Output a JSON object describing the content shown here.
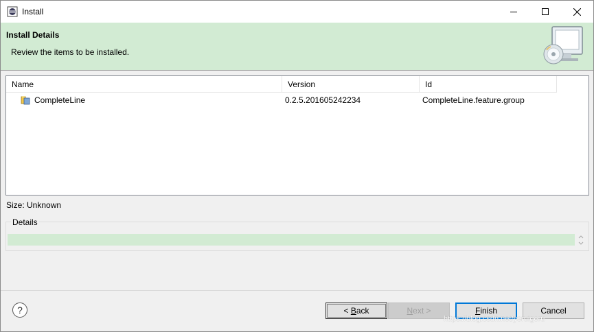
{
  "window": {
    "title": "Install",
    "controls": [
      "minimize-icon",
      "maximize-icon",
      "close-icon"
    ]
  },
  "banner": {
    "title": "Install Details",
    "description": "Review the items to be installed.",
    "icon": "install-monitor-cd-icon",
    "background": "#d2ebd3"
  },
  "table": {
    "columns": [
      "Name",
      "Version",
      "Id"
    ],
    "rows": [
      {
        "name": "CompleteLine",
        "version": "0.2.5.201605242234",
        "id": "CompleteLine.feature.group",
        "icon": "feature-icon"
      }
    ]
  },
  "size": {
    "label": "Size: Unknown"
  },
  "details": {
    "legend": "Details",
    "value": ""
  },
  "buttons": {
    "back_prefix": "< ",
    "back_mnemonic": "B",
    "back_rest": "ack",
    "next_mnemonic": "N",
    "next_rest": "ext >",
    "finish_mnemonic": "F",
    "finish_rest": "inish",
    "cancel": "Cancel",
    "help": "?"
  },
  "watermark": "https://blog.csdn.net/yeruigeru"
}
